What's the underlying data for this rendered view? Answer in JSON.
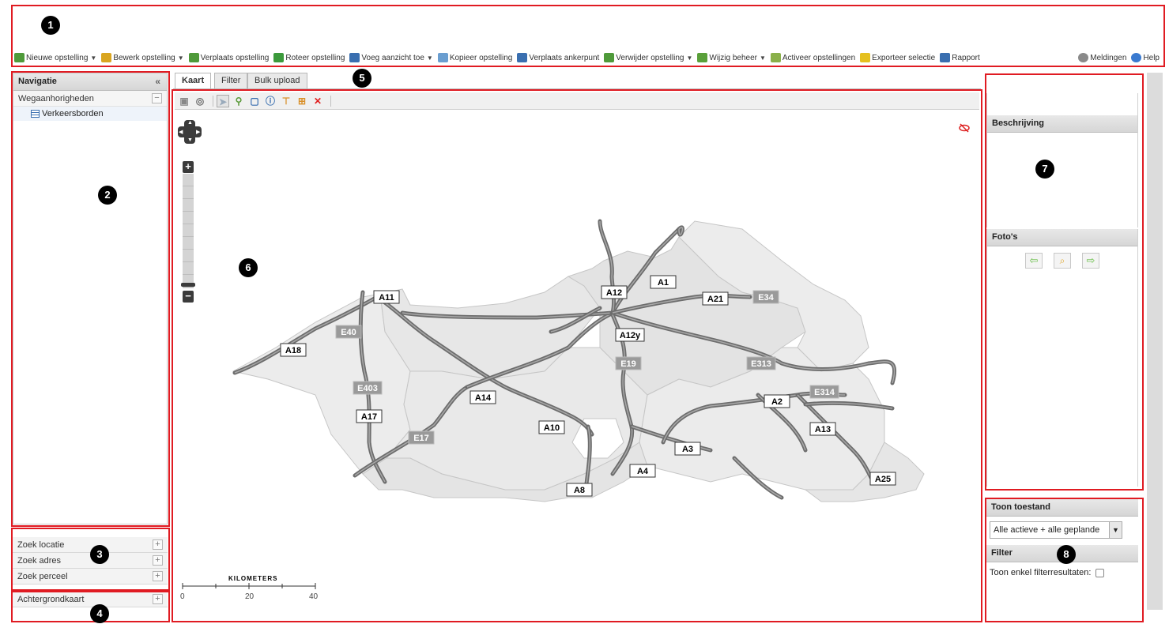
{
  "markers": [
    "1",
    "2",
    "3",
    "4",
    "5",
    "6",
    "7",
    "8"
  ],
  "toolbar": {
    "items": [
      {
        "label": "Nieuwe opstelling",
        "dropdown": true,
        "icon": "new-sign-icon",
        "color": "#4f9a3a"
      },
      {
        "label": "Bewerk opstelling",
        "dropdown": true,
        "icon": "edit-pencil-icon",
        "color": "#d9a520"
      },
      {
        "label": "Verplaats opstelling",
        "dropdown": false,
        "icon": "move-sign-icon",
        "color": "#4f9a3a"
      },
      {
        "label": "Roteer opstelling",
        "dropdown": false,
        "icon": "rotate-icon",
        "color": "#3c9a3c"
      },
      {
        "label": "Voeg aanzicht toe",
        "dropdown": true,
        "icon": "add-view-icon",
        "color": "#3a6fb0"
      },
      {
        "label": "Kopieer opstelling",
        "dropdown": false,
        "icon": "copy-icon",
        "color": "#6a9ed0"
      },
      {
        "label": "Verplaats ankerpunt",
        "dropdown": false,
        "icon": "anchor-icon",
        "color": "#3a6fb0"
      },
      {
        "label": "Verwijder opstelling",
        "dropdown": true,
        "icon": "delete-sign-icon",
        "color": "#4f9a3a"
      },
      {
        "label": "Wijzig beheer",
        "dropdown": true,
        "icon": "manage-icon",
        "color": "#5aa03a"
      },
      {
        "label": "Activeer opstellingen",
        "dropdown": false,
        "icon": "activate-icon",
        "color": "#8ab04a"
      },
      {
        "label": "Exporteer selectie",
        "dropdown": false,
        "icon": "export-icon",
        "color": "#e5c020"
      },
      {
        "label": "Rapport",
        "dropdown": false,
        "icon": "report-icon",
        "color": "#3a6fb0"
      }
    ],
    "right_items": [
      {
        "label": "Meldingen",
        "icon": "notifications-icon",
        "color": "#8a8a8a"
      },
      {
        "label": "Help",
        "icon": "help-icon",
        "color": "#3a7ad0"
      }
    ]
  },
  "navigation": {
    "title": "Navigatie",
    "group": "Wegaanhorigheden",
    "child": "Verkeersborden"
  },
  "search": {
    "items": [
      "Zoek locatie",
      "Zoek adres",
      "Zoek perceel"
    ]
  },
  "background": {
    "label": "Achtergrondkaart"
  },
  "tabs": [
    "Kaart",
    "Filter",
    "Bulk upload"
  ],
  "map_tools": [
    "zoom-extent-icon",
    "identify-icon",
    "select-icon",
    "point-icon",
    "box-icon",
    "info-icon",
    "measure-icon",
    "crop-icon",
    "clear-icon"
  ],
  "roads": {
    "a_labels": [
      "A11",
      "A12",
      "A1",
      "A21",
      "A18",
      "A12y",
      "A14",
      "A17",
      "A2",
      "A10",
      "A13",
      "A3",
      "A4",
      "A8",
      "A25"
    ],
    "e_labels": [
      "E34",
      "E40",
      "E19",
      "E313",
      "E403",
      "E314",
      "E17"
    ]
  },
  "scale": {
    "title": "KILOMETERS",
    "ticks": [
      "0",
      "20",
      "40"
    ]
  },
  "description": {
    "title": "Beschrijving"
  },
  "photos": {
    "title": "Foto's"
  },
  "status": {
    "title": "Toon toestand",
    "selected": "Alle actieve + alle geplande"
  },
  "filter": {
    "title": "Filter",
    "checkbox_label": "Toon enkel filterresultaten:"
  },
  "colors": {
    "annotation": "#e01b22",
    "road": "#777777",
    "region": "#ececec"
  }
}
